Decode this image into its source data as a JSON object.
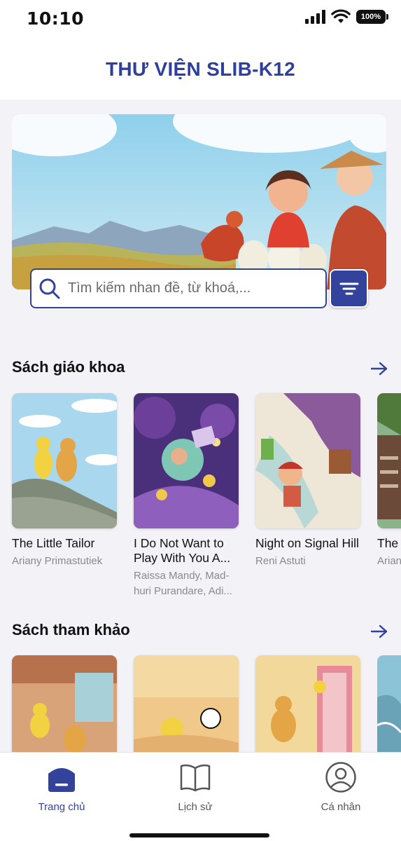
{
  "status": {
    "time": "10:10",
    "battery": "100%"
  },
  "header": {
    "title": "THƯ VIỆN SLIB-K12"
  },
  "search": {
    "placeholder": "Tìm kiếm nhan đề, từ khoá,..."
  },
  "sections": {
    "textbooks": {
      "title": "Sách giáo khoa",
      "books": [
        {
          "title": "The Little Tailor",
          "author": "Ariany Primastutiek"
        },
        {
          "title": "I Do Not Want to Play With You A...",
          "author": "Raissa Mandy, Mad-huri Purandare, Adi..."
        },
        {
          "title": "Night on Signal Hill",
          "author": "Reni Astuti"
        },
        {
          "title": "The",
          "author": "Arian"
        }
      ]
    },
    "reference": {
      "title": "Sách tham khảo"
    }
  },
  "nav": {
    "home": "Trang chủ",
    "history": "Lịch sử",
    "profile": "Cá nhân"
  },
  "colors": {
    "primary": "#33429a",
    "title": "#2e3f9e"
  }
}
